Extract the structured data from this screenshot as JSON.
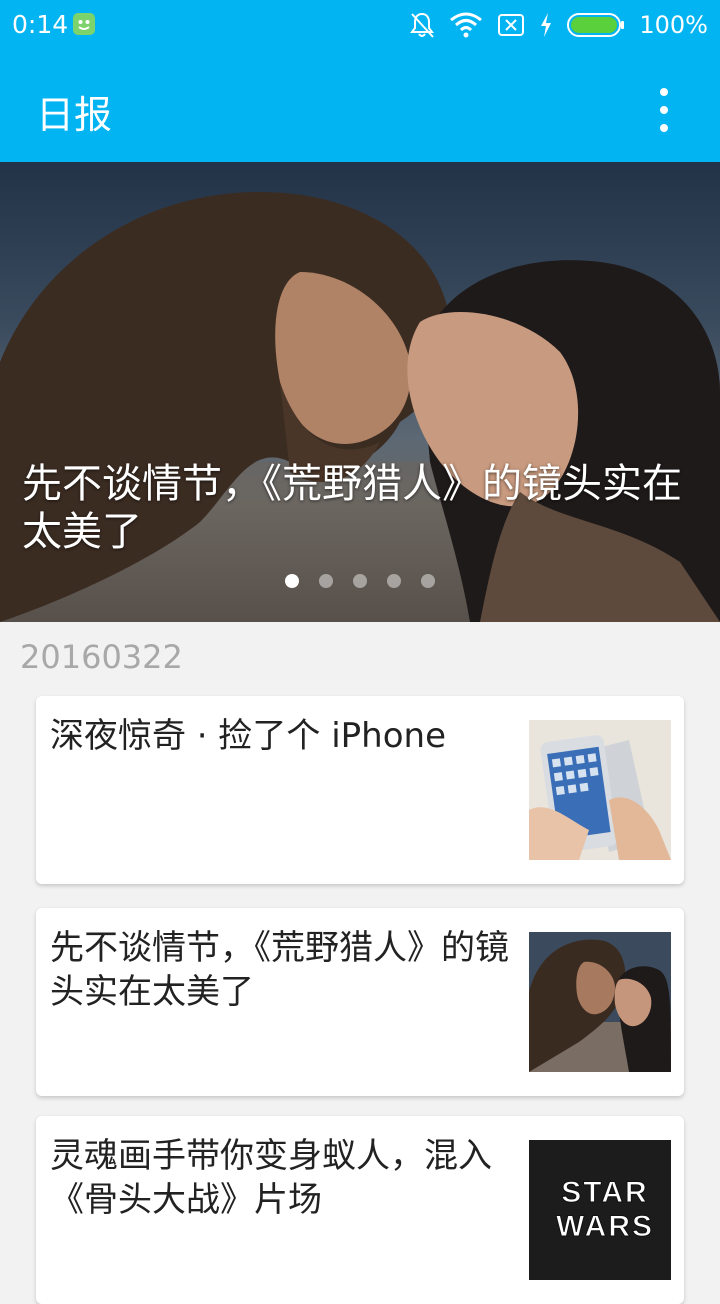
{
  "status_bar": {
    "time": "0:14",
    "battery_percent": "100%",
    "icons": [
      "app-notification-icon",
      "mute-bell-icon",
      "wifi-icon",
      "no-sim-icon",
      "charging-icon",
      "battery-icon"
    ]
  },
  "app_bar": {
    "title": "日报",
    "menu_icon": "more-vert-icon"
  },
  "banner": {
    "title": "先不谈情节，《荒野猎人》的镜头实在太美了",
    "page_count": 5,
    "active_page": 1
  },
  "feed": {
    "date": "20160322",
    "stories": [
      {
        "title": "深夜惊奇 · 捡了个 iPhone"
      },
      {
        "title": "先不谈情节，《荒野猎人》的镜头实在太美了"
      },
      {
        "title": "灵魂画手带你变身蚁人，混入《骨头大战》片场",
        "thumb_text": "STAR WARS"
      }
    ]
  },
  "colors": {
    "primary": "#03b4f2",
    "background": "#f2f2f2",
    "date_text": "#a8a8a8"
  }
}
